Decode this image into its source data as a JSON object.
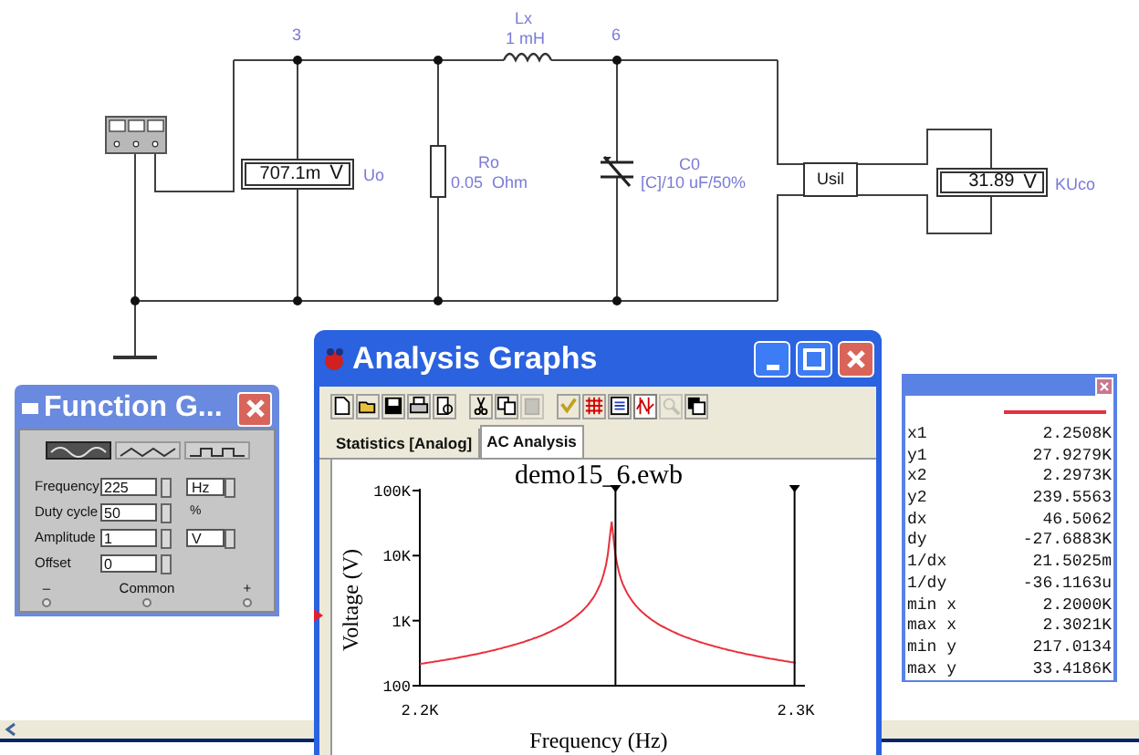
{
  "schematic": {
    "nodes": [
      {
        "label": "3"
      },
      {
        "label": "6"
      }
    ],
    "voltmeters": [
      {
        "reading": "707.1m",
        "unit": "V",
        "label": "Uo"
      },
      {
        "reading": "31.89",
        "unit": "V",
        "label": "KUco"
      }
    ],
    "resistor": {
      "name": "Ro",
      "value": "0.05  Ohm"
    },
    "inductor": {
      "name": "Lx",
      "value": "1 mH"
    },
    "capacitor": {
      "name": "C0",
      "value": "[C]/10 uF/50%"
    },
    "subcircuit": {
      "label": "Usil"
    }
  },
  "function_generator": {
    "title": "Function G...",
    "waveforms": [
      {
        "kind": "sine",
        "selected": true
      },
      {
        "kind": "triangle",
        "selected": false
      },
      {
        "kind": "square",
        "selected": false
      }
    ],
    "fields": [
      {
        "label": "Frequency",
        "value": "225",
        "unit": {
          "text": "Hz",
          "kind": "select"
        }
      },
      {
        "label": "Duty cycle",
        "value": "50",
        "unit": {
          "text": "%",
          "kind": "label"
        }
      },
      {
        "label": "Amplitude",
        "value": "1",
        "unit": {
          "text": "V",
          "kind": "select"
        }
      },
      {
        "label": "Offset",
        "value": "0"
      }
    ],
    "terminals": [
      "–",
      "Common",
      "+"
    ]
  },
  "analysis_graphs": {
    "title": "Analysis Graphs",
    "toolbar": [
      {
        "kind": "new",
        "disabled": false,
        "pressed": false
      },
      {
        "kind": "open",
        "disabled": false,
        "pressed": false
      },
      {
        "kind": "save",
        "disabled": false,
        "pressed": false
      },
      {
        "kind": "print",
        "disabled": false,
        "pressed": false
      },
      {
        "kind": "preview",
        "disabled": false,
        "pressed": false
      },
      {
        "kind": "cut",
        "disabled": false,
        "pressed": false
      },
      {
        "kind": "copy",
        "disabled": false,
        "pressed": false
      },
      {
        "kind": "paste",
        "disabled": true,
        "pressed": false
      },
      {
        "kind": "properties",
        "disabled": false,
        "pressed": false
      },
      {
        "kind": "grid",
        "disabled": false,
        "pressed": false
      },
      {
        "kind": "legend",
        "disabled": false,
        "pressed": false
      },
      {
        "kind": "cursors",
        "disabled": false,
        "pressed": true
      },
      {
        "kind": "zoom",
        "disabled": true,
        "pressed": false
      },
      {
        "kind": "reverse",
        "disabled": false,
        "pressed": false
      }
    ],
    "tabs": [
      {
        "label": "Statistics [Analog]",
        "selected": false
      },
      {
        "label": "AC Analysis",
        "selected": true
      }
    ],
    "graph": {
      "title": "demo15_6.ewb",
      "xlabel": "Frequency (Hz)",
      "ylabel": "Voltage (V)",
      "x_tick_labels": [
        "2.2K",
        "2.3K"
      ],
      "y_tick_labels": [
        "100K",
        "10K",
        "1K",
        "100"
      ]
    },
    "cursors": [
      {
        "level": 0.508
      },
      {
        "level": 0.973
      }
    ]
  },
  "cursor_readout": {
    "rows": [
      {
        "label": "x1",
        "value": "2.2508K"
      },
      {
        "label": "y1",
        "value": "27.9279K"
      },
      {
        "label": "x2",
        "value": "2.2973K"
      },
      {
        "label": "y2",
        "value": "239.5563"
      },
      {
        "label": "dx",
        "value": "46.5062"
      },
      {
        "label": "dy",
        "value": "-27.6883K"
      },
      {
        "label": "1/dx",
        "value": "21.5025m"
      },
      {
        "label": "1/dy",
        "value": "-36.1163u"
      },
      {
        "label": "min x",
        "value": "2.2000K"
      },
      {
        "label": "max x",
        "value": "2.3021K"
      },
      {
        "label": "min y",
        "value": "217.0134"
      },
      {
        "label": "max y",
        "value": "33.4186K"
      }
    ]
  }
}
